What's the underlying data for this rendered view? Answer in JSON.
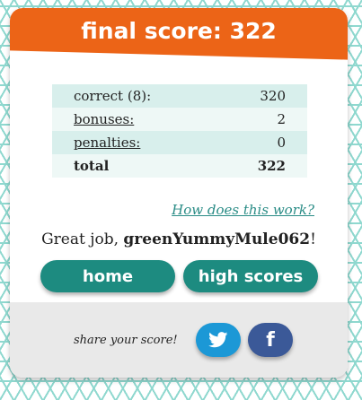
{
  "banner": {
    "title": "final score: 322"
  },
  "score_table": {
    "rows": [
      {
        "label": "correct (8):",
        "value": "320"
      },
      {
        "label": "bonuses:",
        "value": "2"
      },
      {
        "label": "penalties:",
        "value": "0"
      },
      {
        "label": "total",
        "value": "322"
      }
    ]
  },
  "help_link": "How does this work?",
  "message": {
    "prefix": "Great job, ",
    "username": "greenYummyMule062",
    "suffix": "!"
  },
  "buttons": {
    "home": "home",
    "high_scores": "high scores"
  },
  "share": {
    "label": "share your score!",
    "twitter_icon": "twitter-icon",
    "facebook_icon": "facebook-icon",
    "twitter_color": "#1c98d6",
    "facebook_color": "#3b5998"
  },
  "colors": {
    "banner": "#ec6417",
    "button": "#1d8b80",
    "background_pattern": "#8fd8cf"
  }
}
